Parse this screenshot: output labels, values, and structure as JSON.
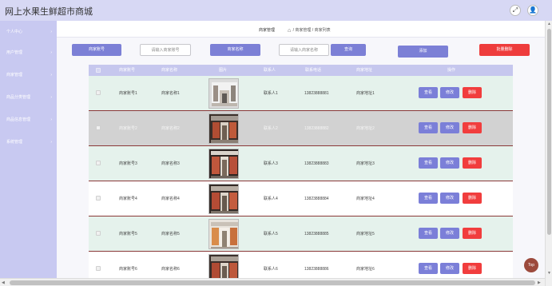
{
  "app": {
    "title": "网上水果生鲜超市商城"
  },
  "header_icons": {
    "fullscreen": "⤢",
    "user": "👤"
  },
  "sidebar": {
    "items": [
      {
        "label": "个人中心"
      },
      {
        "label": "用户管理"
      },
      {
        "label": "商家管理"
      },
      {
        "label": "商品分类管理"
      },
      {
        "label": "商品信息管理"
      },
      {
        "label": "系统管理"
      }
    ],
    "chevron": "›"
  },
  "breadcrumb": {
    "title": "商家管理",
    "home_icon": "⌂",
    "path": "/ 商家管理 / 商家列表"
  },
  "toolbar": {
    "account_label": "商家账号",
    "account_placeholder": "请输入商家账号",
    "name_label": "商家名称",
    "name_placeholder": "请输入商家名称",
    "search_button": "查询",
    "add_button": "添加",
    "batch_delete_button": "批量删除"
  },
  "table": {
    "headers": [
      "商家账号",
      "商家名称",
      "图片",
      "联系人",
      "联系电话",
      "商家地址",
      "操作"
    ],
    "rows": [
      {
        "account": "商家账号1",
        "name": "商家名称1",
        "contact": "联系人1",
        "phone": "13823888881",
        "address": "商家地址1"
      },
      {
        "account": "商家账号2",
        "name": "商家名称2",
        "contact": "联系人2",
        "phone": "13823888882",
        "address": "商家地址2"
      },
      {
        "account": "商家账号3",
        "name": "商家名称3",
        "contact": "联系人3",
        "phone": "13823888883",
        "address": "商家地址3"
      },
      {
        "account": "商家账号4",
        "name": "商家名称4",
        "contact": "联系人4",
        "phone": "13823888884",
        "address": "商家地址4"
      },
      {
        "account": "商家账号5",
        "name": "商家名称5",
        "contact": "联系人5",
        "phone": "13823888885",
        "address": "商家地址5"
      },
      {
        "account": "商家账号6",
        "name": "商家名称6",
        "contact": "联系人6",
        "phone": "13823888886",
        "address": "商家地址6"
      }
    ],
    "actions": {
      "view": "查看",
      "edit": "修改",
      "delete": "删除"
    }
  },
  "back_to_top": "Top",
  "colors": {
    "accent": "#7c80d6",
    "danger": "#ee3c3c",
    "sidebar": "#c8c9f1",
    "topbar": "#d7d8f4",
    "row_alt": "#e5f2ec"
  }
}
